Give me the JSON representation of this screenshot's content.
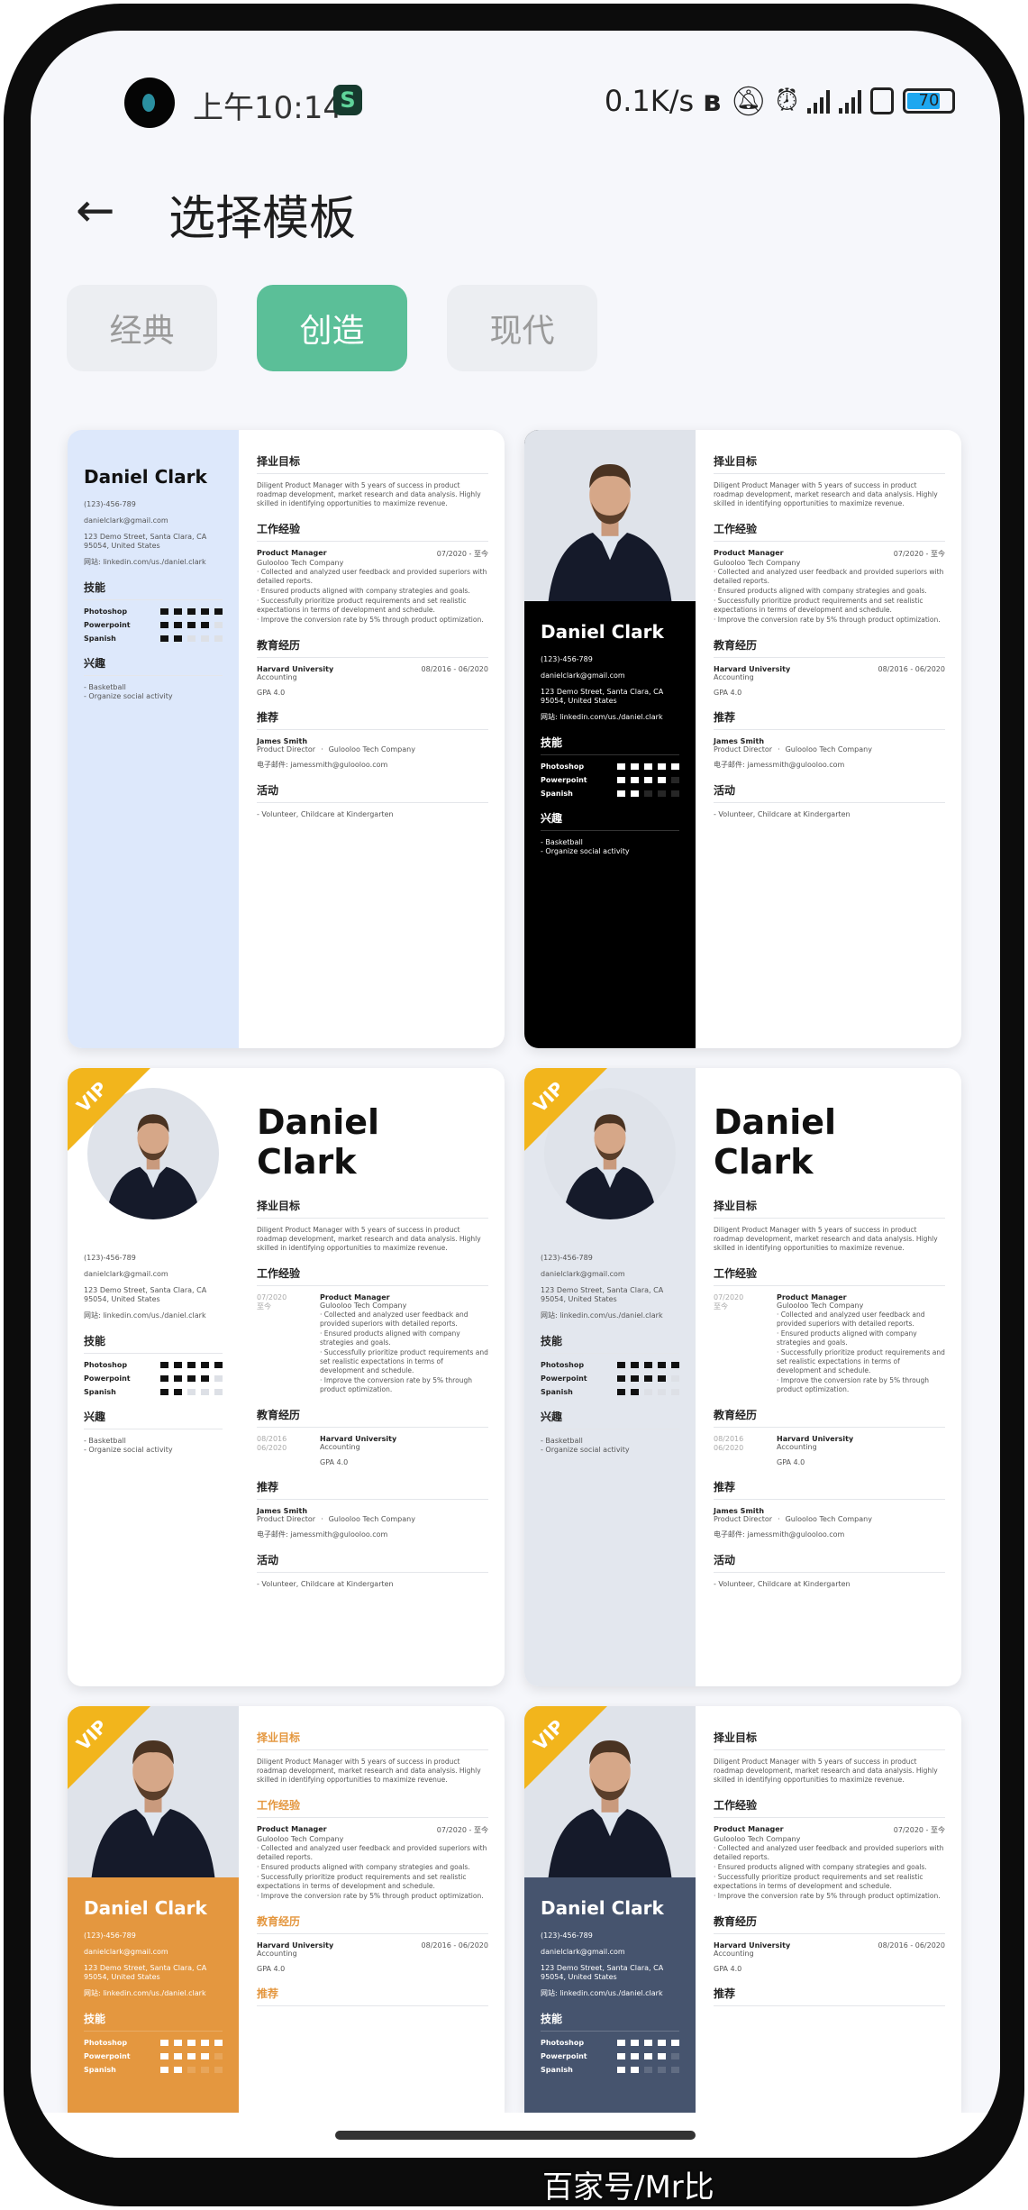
{
  "status": {
    "time": "上午10:14",
    "net": "0.1K/s",
    "battery": "70"
  },
  "header": {
    "title": "选择模板",
    "back_icon": "arrow-left"
  },
  "tabs": [
    {
      "label": "经典"
    },
    {
      "label": "创造",
      "active": true
    },
    {
      "label": "现代"
    }
  ],
  "colors": {
    "accent": "#5bbf98",
    "vip": "#f2b51c",
    "orange": "#e4973f",
    "slate": "#46546e"
  },
  "vip_label": "VIP",
  "resume": {
    "name": "Daniel Clark",
    "phone": "(123)-456-789",
    "email": "danielclark@gmail.com",
    "address": "123 Demo Street, Santa Clara, CA 95054, United States",
    "website": "网站: linkedin.com/us./daniel.clark",
    "skills_title": "技能",
    "skills": [
      {
        "name": "Photoshop",
        "level": 5
      },
      {
        "name": "Powerpoint",
        "level": 4
      },
      {
        "name": "Spanish",
        "level": 2
      }
    ],
    "interests_title": "兴趣",
    "interests": [
      "- Basketball",
      "- Organize social activity"
    ],
    "objective_title": "择业目标",
    "objective": "Diligent Product Manager with 5 years of success in product roadmap development, market research and data analysis. Highly skilled in identifying opportunities to maximize revenue.",
    "work_title": "工作经验",
    "job": {
      "title": "Product Manager",
      "company": "Gulooloo Tech Company",
      "date": "07/2020 - 至今",
      "start": "07/2020",
      "end": "至今",
      "bullets": [
        "· Collected and analyzed user feedback and provided superiors with detailed reports.",
        "· Ensured products aligned with company strategies and goals.",
        "· Successfully prioritize product requirements and set realistic expectations in terms of development and schedule.",
        "· Improve the conversion rate by 5% through product optimization."
      ]
    },
    "edu_title": "教育经历",
    "edu": {
      "school": "Harvard University",
      "major": "Accounting",
      "date": "08/2016 - 06/2020",
      "start": "08/2016",
      "end": "06/2020",
      "gpa": "GPA 4.0"
    },
    "ref_title": "推荐",
    "ref": {
      "name": "James Smith",
      "title": "Product Director",
      "sep": "·",
      "company": "Gulooloo Tech Company",
      "email": "电子邮件: jamessmith@gulooloo.com"
    },
    "activity_title": "活动",
    "activities": [
      "- Volunteer, Childcare at Kindergarten"
    ]
  },
  "templates": [
    {
      "layout": "plain",
      "sidebar": "#dde8fb",
      "dark": false,
      "vip": false
    },
    {
      "layout": "photo",
      "sidebar": "#000000",
      "dark": true,
      "vip": false
    },
    {
      "layout": "circle",
      "sidebar": "#ffffff",
      "dark": false,
      "vip": true
    },
    {
      "layout": "circle",
      "sidebar": "#e3e7ee",
      "dark": false,
      "vip": true
    },
    {
      "layout": "photo",
      "sidebar": "#e4973f",
      "dark": true,
      "vip": true,
      "title_color": "#e4973f"
    },
    {
      "layout": "photo",
      "sidebar": "#46546e",
      "dark": true,
      "vip": true
    }
  ],
  "watermark": "百家号/Mr比"
}
